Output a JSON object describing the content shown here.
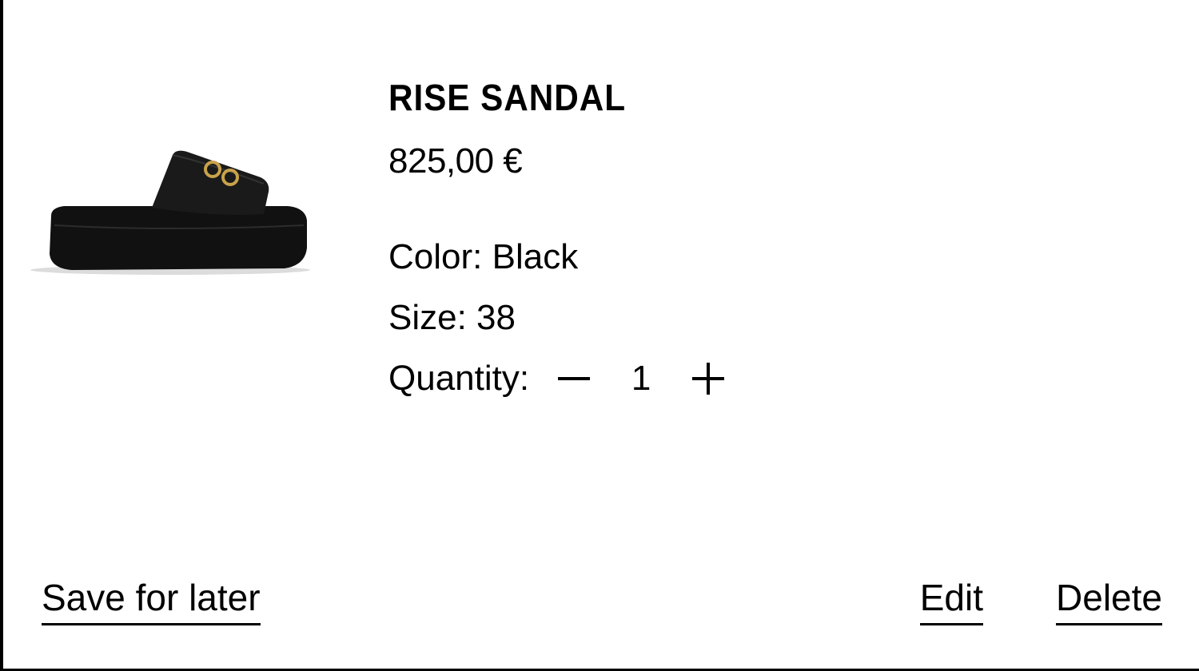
{
  "product": {
    "name": "RISE SANDAL",
    "price": "825,00 €",
    "color": "Color: Black",
    "size": "Size: 38",
    "quantity_label": "Quantity:",
    "quantity_value": "1",
    "image_icon": "black-platform-slide-sandal"
  },
  "controls": {
    "decrement_symbol": "−",
    "increment_symbol": "+"
  },
  "actions": {
    "save_for_later": "Save for later",
    "edit": "Edit",
    "delete": "Delete"
  },
  "colors": {
    "text": "#000000",
    "background": "#ffffff",
    "buckle": "#c9a24a"
  }
}
